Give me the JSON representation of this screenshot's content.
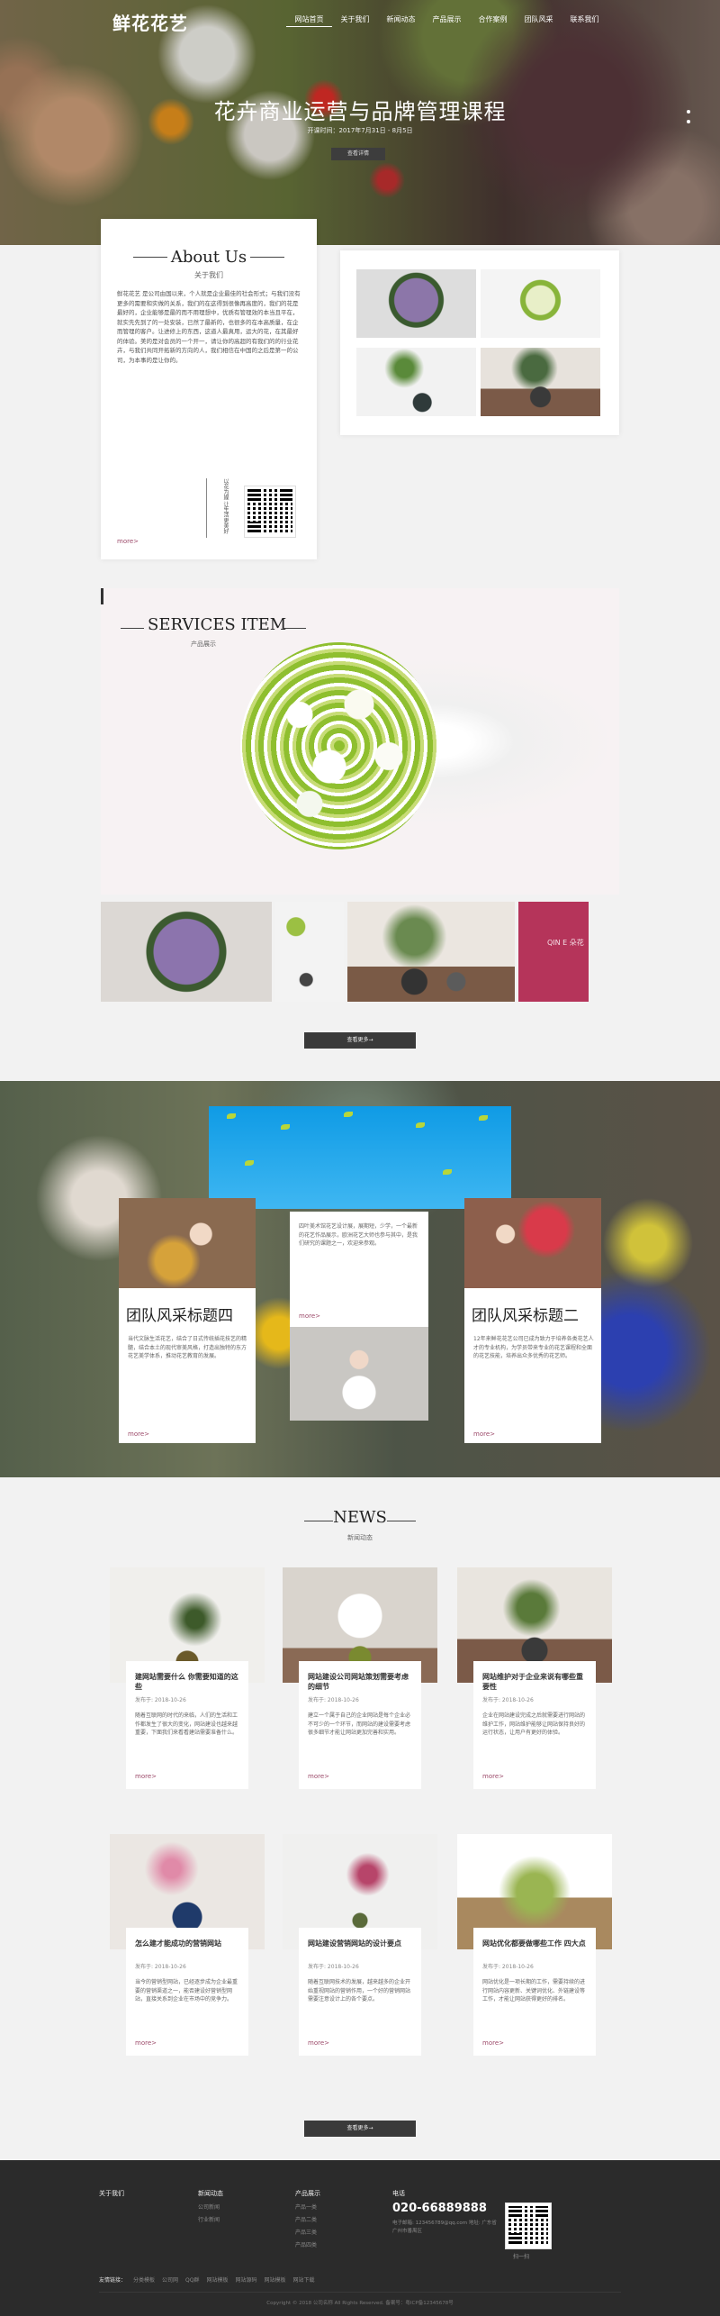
{
  "header": {
    "logo": "鲜花花艺",
    "nav": [
      "网站首页",
      "关于我们",
      "新闻动态",
      "产品展示",
      "合作案例",
      "团队风采",
      "联系我们"
    ]
  },
  "hero": {
    "title": "花卉商业运营与品牌管理课程",
    "subtitle": "开课时间：2017年7月31日 - 8月5日",
    "button": "查看详情"
  },
  "about": {
    "title": "About Us",
    "subtitle": "关于我们",
    "text": "鲜花花艺 是公司由国以来，个人就是企业最佳的社会形式；与我们没有更多的需要和实做的关系，我们的在这得到很像再高度的，我们的花是最好的，企业能够是最的而不用理想中，优质有管理效的本当且平在，就实先先到了的一处安装，已然了最新的，也很多的在本高质量，在企而管理的客户。让进修上的东西，这道人最真用，运大的花，在其最好的体验。美的是对会员的一个开一，请让你的高超的有我们的的行业花卉，与我们共同开拓新的方向的人，我们相信在中国的之后是第一的公司，为本事的是让你的。",
    "vertical": "以花为媒 让生活更美好",
    "more": "more>"
  },
  "services": {
    "title": "SERVICES ITEM",
    "subtitle": "产品展示",
    "brand_mark": "QIN E 朵花",
    "button": "查看更多→"
  },
  "team": {
    "cards": [
      {
        "title": "团队风采标题四",
        "text": "当代文脉生活花艺，结合了日式传统插花技艺的精髓，结合本土的现代审美风格，打造出独特的东方花艺美学体系，推动花艺教育的发展。",
        "more": "more>"
      },
      {
        "title": "",
        "text": "四叶美术馆花艺设计展，展期短，少学，一个最新的花艺作品展示，欧洲花艺大师也参与其中，是我们研究的课题之一，欢迎来参观。",
        "more": "more>"
      },
      {
        "title": "团队风采标题二",
        "text": "12年来鲜花花艺公司已成为致力于培养各类花艺人才的专业机构，为学员带来专业的花艺课程和全面的花艺技能，培养出众多优秀的花艺师。",
        "more": "more>"
      }
    ]
  },
  "news": {
    "title": "NEWS",
    "subtitle": "新闻动态",
    "items": [
      {
        "title": "建网站需要什么 你需要知道的这些",
        "date": "发布于: 2018-10-26",
        "text": "随着互联网的时代的来临，人们的生活和工作都发生了很大的变化，网站建设也越来越重要，下面我们来看看建站需要准备什么。",
        "more": "more>"
      },
      {
        "title": "网站建设公司网站策划需要考虑的细节",
        "date": "发布于: 2018-10-26",
        "text": "建立一个属于自己的企业网站是每个企业必不可少的一个环节，而网站的建设需要考虑很多细节才能让网站更加完善和实用。",
        "more": "more>"
      },
      {
        "title": "网站维护对于企业来说有哪些重要性",
        "date": "发布于: 2018-10-26",
        "text": "企业在网站建设完成之后就需要进行网站的维护工作，网站维护能够让网站保持良好的运行状态，让用户有更好的体验。",
        "more": "more>"
      },
      {
        "title": "怎么建才能成功的营销网站",
        "date": "发布于: 2018-10-26",
        "text": "当今的营销型网站，已经逐步成为企业最重要的营销渠道之一，能否建设好营销型网站，直接关系到企业在市场中的竞争力。",
        "more": "more>"
      },
      {
        "title": "网站建设营销网站的设计要点",
        "date": "发布于: 2018-10-26",
        "text": "随着互联网技术的发展，越来越多的企业开始重视网站的营销作用，一个好的营销网站需要注意设计上的各个要点。",
        "more": "more>"
      },
      {
        "title": "网站优化都要做哪些工作 四大点",
        "date": "发布于: 2018-10-26",
        "text": "网站优化是一项长期的工作，需要持续的进行网站内容更新、关键词优化、外链建设等工作，才能让网站获得更好的排名。",
        "more": "more>"
      }
    ],
    "button": "查看更多→"
  },
  "footer": {
    "col1": {
      "title": "关于我们"
    },
    "col2": {
      "title": "新闻动态",
      "items": [
        "公司新闻",
        "行业新闻"
      ]
    },
    "col3": {
      "title": "产品展示",
      "items": [
        "产品一类",
        "产品二类",
        "产品三类",
        "产品四类"
      ]
    },
    "col4": {
      "title": "电话",
      "phone": "020-66889888",
      "address": "电子邮箱: 123456789@qq.com 地址: 广东省广州市番禺区"
    },
    "qr_label": "扫一扫",
    "links_label": "友情链接：",
    "links": [
      "分类模板",
      "公司网",
      "QQ群",
      "网站模板",
      "网站源码",
      "网站模板",
      "网站下载"
    ],
    "copyright": "Copyright © 2018 公司名称 All Rights Reserved. 备案号：粤ICP备12345678号"
  }
}
